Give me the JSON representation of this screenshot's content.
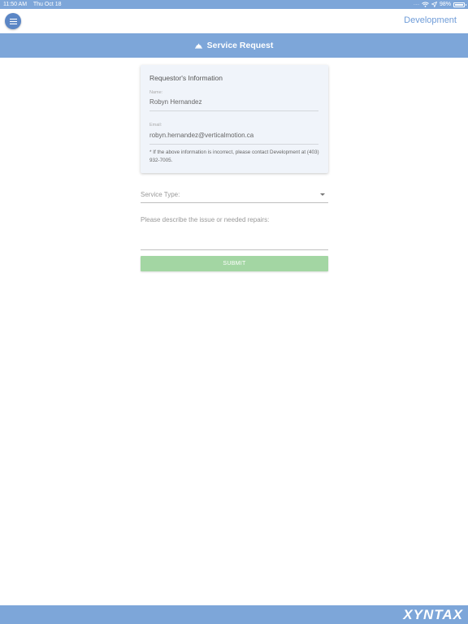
{
  "status_bar": {
    "time": "11:50 AM",
    "date": "Thu Oct 18",
    "signal_dots": ".....",
    "battery": "98%"
  },
  "header": {
    "title": "Development",
    "menu_icon": "hamburger-menu-icon"
  },
  "title_bar": {
    "icon": "service-bell-icon",
    "title": "Service Request"
  },
  "requestor": {
    "heading": "Requestor's Information",
    "name_label": "Name:",
    "name_value": "Robyn Hernandez",
    "email_label": "Email:",
    "email_value": "robyn.hernandez@verticalmotion.ca",
    "note": "* If the above information is incorrect, please contact Development at (403) 932-7005."
  },
  "form": {
    "service_type_label": "Service Type:",
    "service_type_value": "",
    "description_label": "Please describe the issue or needed repairs:",
    "description_value": "",
    "submit_label": "SUBMIT"
  },
  "footer": {
    "logo_text": "XYNTAX"
  },
  "colors": {
    "primary": "#7da6d9",
    "menu_button": "#5b86c5",
    "header_title": "#6f9cd8",
    "card_background": "#f0f4fa",
    "submit": "#a3d6a3"
  }
}
